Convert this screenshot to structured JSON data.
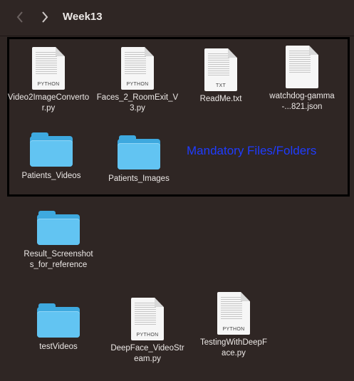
{
  "window": {
    "title": "Week13"
  },
  "annotation": {
    "text": "Mandatory Files/Folders",
    "color": "#1f3cff"
  },
  "items": [
    {
      "label": "Video2ImageConvertor.py",
      "kind": "document",
      "tag": "PYTHON"
    },
    {
      "label": "Faces_2_RoomExit_V3.py",
      "kind": "document",
      "tag": "PYTHON"
    },
    {
      "label": "ReadMe.txt",
      "kind": "document",
      "tag": "TXT"
    },
    {
      "label": "watchdog-gamma-...821.json",
      "kind": "document",
      "tag": ""
    },
    {
      "label": "Patients_Videos",
      "kind": "folder",
      "tag": ""
    },
    {
      "label": "Patients_Images",
      "kind": "folder",
      "tag": ""
    },
    {
      "label": "Result_Screenshots_for_reference",
      "kind": "folder",
      "tag": ""
    },
    {
      "label": "testVideos",
      "kind": "folder",
      "tag": ""
    },
    {
      "label": "DeepFace_VideoStream.py",
      "kind": "document",
      "tag": "PYTHON"
    },
    {
      "label": "TestingWithDeepFace.py",
      "kind": "document",
      "tag": "PYTHON"
    }
  ],
  "icons": {
    "back": "chevron-left-icon",
    "forward": "chevron-right-icon",
    "folder": "folder-icon",
    "document": "document-icon"
  },
  "colors": {
    "background": "#2f2624",
    "folder": "#62c4f2",
    "highlight_border": "#000000"
  }
}
